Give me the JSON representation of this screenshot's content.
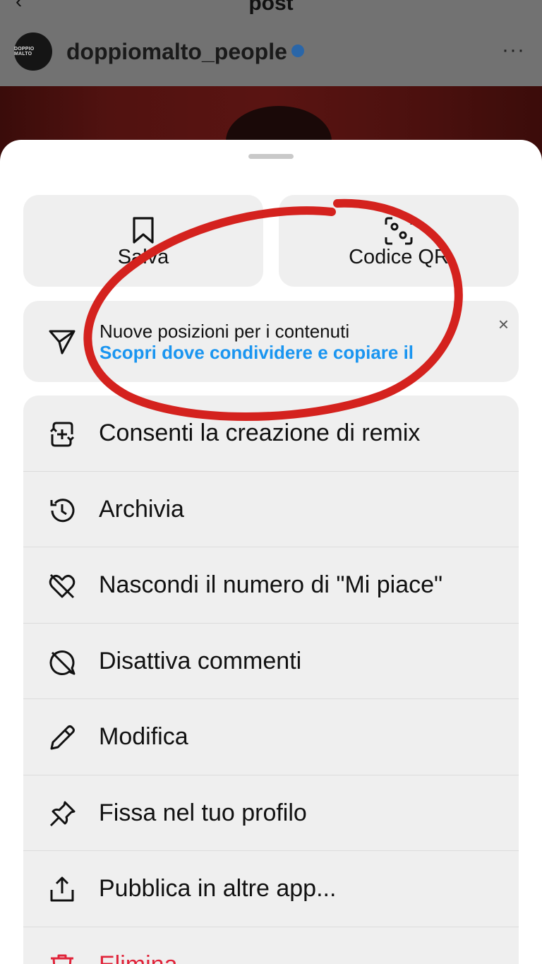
{
  "header": {
    "title": "post",
    "username": "doppiomalto_people",
    "avatar_text": "DOPPIO MALTO",
    "more_glyph": "···"
  },
  "sheet": {
    "tiles": [
      {
        "label": "Salva",
        "icon": "bookmark-icon"
      },
      {
        "label": "Codice QR",
        "icon": "qr-code-icon"
      }
    ],
    "promo": {
      "title": "Nuove posizioni per i contenuti",
      "link": "Scopri dove condividere e copiare il",
      "close": "×",
      "icon": "send-icon"
    },
    "menu": [
      {
        "label": "Consenti la creazione di remix",
        "icon": "remix-icon"
      },
      {
        "label": "Archivia",
        "icon": "archive-history-icon"
      },
      {
        "label": "Nascondi il numero di \"Mi piace\"",
        "icon": "heart-off-icon"
      },
      {
        "label": "Disattiva commenti",
        "icon": "comment-off-icon"
      },
      {
        "label": "Modifica",
        "icon": "pencil-icon"
      },
      {
        "label": "Fissa nel tuo profilo",
        "icon": "pin-icon"
      },
      {
        "label": "Pubblica in altre app...",
        "icon": "share-icon"
      },
      {
        "label": "Elimina",
        "icon": "trash-icon",
        "color": "#e0243a"
      }
    ]
  },
  "colors": {
    "link": "#1a95f0",
    "danger": "#e0243a",
    "annotation": "#d4221e"
  }
}
